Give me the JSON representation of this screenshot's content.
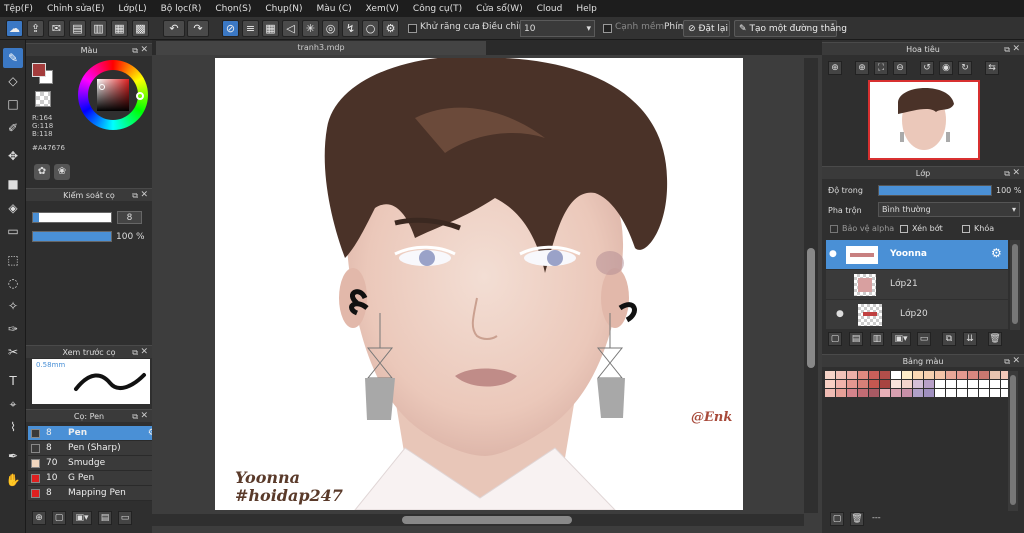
{
  "menu": [
    "Tệp(F)",
    "Chỉnh sửa(E)",
    "Lớp(L)",
    "Bộ lọc(R)",
    "Chọn(S)",
    "Chụp(N)",
    "Màu (C)",
    "Xem(V)",
    "Công cụ(T)",
    "Cửa sổ(W)",
    "Cloud",
    "Help"
  ],
  "toolbar": {
    "antialias_label": "Khử răng cưa",
    "adjust_label": "Điều chỉnh",
    "adjust_value": "10",
    "soft_edge_label": "Cạnh mềm",
    "key_label": "Phím",
    "reset_label": "Đặt lại",
    "line_label": "Tạo một đường thẳng"
  },
  "color_panel": {
    "title": "Màu",
    "r": "R:164",
    "g": "G:118",
    "b": "B:118",
    "hex": "#A47676",
    "fg": "#a43c3c",
    "bg": "#ffffff"
  },
  "brush_control": {
    "title": "Kiểm soát cọ",
    "size": "8",
    "opacity": "100 %",
    "size_fraction": 0.08,
    "opacity_fraction": 1.0
  },
  "brush_preview": {
    "title": "Xem trước cọ",
    "size_label": "0.58mm"
  },
  "brush_list": {
    "title": "Cọ: Pen",
    "items": [
      {
        "size": "8",
        "name": "Pen",
        "color": "#3a3a3a"
      },
      {
        "size": "8",
        "name": "Pen (Sharp)",
        "color": "#3a3a3a"
      },
      {
        "size": "70",
        "name": "Smudge",
        "color": "#f2d8c0"
      },
      {
        "size": "10",
        "name": "G Pen",
        "color": "#e02020"
      },
      {
        "size": "8",
        "name": "Mapping Pen",
        "color": "#e02020"
      }
    ]
  },
  "document": {
    "tab_title": "tranh3.mdp",
    "signature": "@Enk",
    "caption_line1": "Yoonna",
    "caption_line2": "#hoidap247"
  },
  "navigator": {
    "title": "Hoa tiêu"
  },
  "layers": {
    "title": "Lớp",
    "opacity_label": "Độ trong",
    "opacity_value": "100 %",
    "opacity_fraction": 1.0,
    "blend_label": "Pha trộn",
    "blend_value": "Bình thường",
    "protect_alpha": "Bảo vệ alpha",
    "clipping": "Xén bớt",
    "lock": "Khóa",
    "items": [
      {
        "name": "Yoonna",
        "selected": true
      },
      {
        "name": "Lớp21",
        "selected": false
      },
      {
        "name": "Lớp20",
        "selected": false
      }
    ]
  },
  "palette": {
    "title": "Bảng màu",
    "footer": "---",
    "colors": [
      "#f6d4c8",
      "#f2c2b8",
      "#eeb0a8",
      "#e08a80",
      "#c8605a",
      "#b24e4a",
      "#ffffff",
      "#fdecc8",
      "#fad8b4",
      "#f6d0b0",
      "#f4c4a8",
      "#e8a898",
      "#e49a90",
      "#d88880",
      "#c87870",
      "#e8c4b0",
      "#f2c8b8",
      "#f8d0c4",
      "#f0b4ac",
      "#e49890",
      "#d88078",
      "#c45850",
      "#a84440",
      "#f8e4dc",
      "#f2d4cc",
      "#d4c0d8",
      "#b8a0c8",
      "#ffffff",
      "#ffffff",
      "#ffffff",
      "#ffffff",
      "#ffffff",
      "#ffffff",
      "#ffffff",
      "#f0bcb4",
      "#e6a098",
      "#d4848c",
      "#c26c74",
      "#a85a64",
      "#e8b0b8",
      "#d8a0b0",
      "#c890a8",
      "#b0a0c8",
      "#a090c0",
      "#ffffff",
      "#ffffff",
      "#ffffff",
      "#ffffff",
      "#ffffff",
      "#ffffff",
      "#ffffff"
    ]
  }
}
